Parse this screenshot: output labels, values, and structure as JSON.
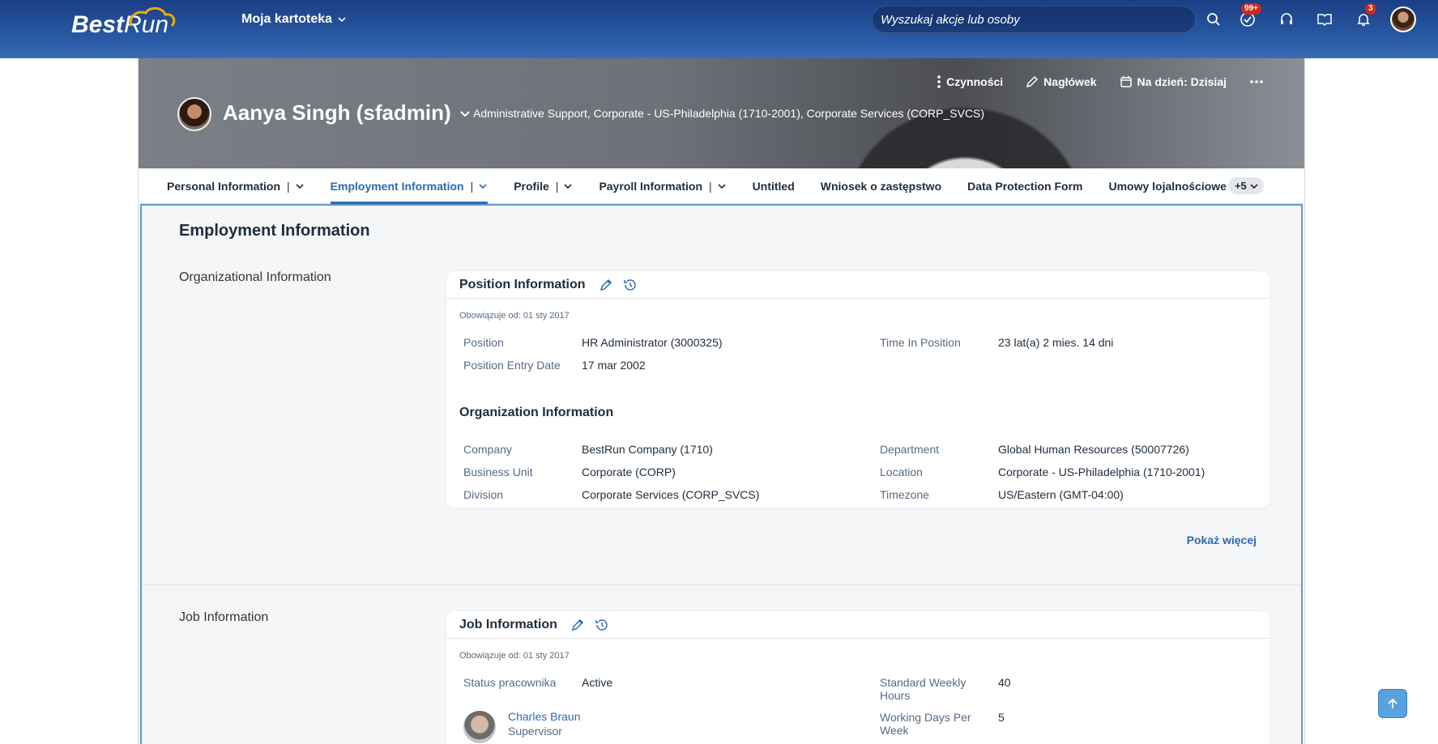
{
  "shell": {
    "logo_best": "Best",
    "logo_run": "Run",
    "menu_title": "Moja kartoteka",
    "search_placeholder": "Wyszukaj akcje lub osoby",
    "todo_badge": "99+",
    "notif_badge": "3",
    "icons": [
      "search-icon",
      "todo-icon",
      "support-icon",
      "learning-icon",
      "bell-icon"
    ]
  },
  "header": {
    "name": "Aanya Singh (sfadmin)",
    "subtitle": "Administrative Support, Corporate - US-Philadelphia (1710-2001), Corporate Services (CORP_SVCS)",
    "actions": {
      "czynnosci": "Czynności",
      "naglowek": "Nagłówek",
      "na_dzien": "Na dzień: Dzisiaj"
    }
  },
  "tabs": [
    {
      "label": "Personal Information"
    },
    {
      "label": "Employment Information"
    },
    {
      "label": "Profile"
    },
    {
      "label": "Payroll Information"
    },
    {
      "label": "Untitled"
    },
    {
      "label": "Wniosek o zastępstwo"
    },
    {
      "label": "Data Protection Form"
    },
    {
      "label": "Umowy lojalnościowe"
    }
  ],
  "tabs_more": "+5",
  "section": {
    "title": "Employment Information",
    "org_label": "Organizational Information",
    "job_label": "Job Information",
    "show_more": "Pokaż więcej"
  },
  "position_card": {
    "title": "Position Information",
    "effective": "Obowiązuje od: 01 sty 2017",
    "fields": {
      "position_label": "Position",
      "position_value": "HR Administrator (3000325)",
      "entry_label": "Position Entry Date",
      "entry_value": "17 mar 2002",
      "time_label": "Time In Position",
      "time_value": "23 lat(a) 2 mies. 14 dni"
    },
    "org_title": "Organization Information",
    "org": {
      "company_label": "Company",
      "company_value": "BestRun Company (1710)",
      "bu_label": "Business Unit",
      "bu_value": "Corporate (CORP)",
      "division_label": "Division",
      "division_value": "Corporate Services (CORP_SVCS)",
      "dept_label": "Department",
      "dept_value": "Global Human Resources (50007726)",
      "location_label": "Location",
      "location_value": "Corporate - US-Philadelphia (1710-2001)",
      "tz_label": "Timezone",
      "tz_value": "US/Eastern (GMT-04:00)"
    }
  },
  "job_card": {
    "title": "Job Information",
    "effective": "Obowiązuje od: 01 sty 2017",
    "status_label": "Status pracownika",
    "status_value": "Active",
    "hours_label": "Standard Weekly Hours",
    "hours_value": "40",
    "days_label": "Working Days Per Week",
    "days_value": "5",
    "supervisor_name": "Charles Braun",
    "supervisor_role": "Supervisor"
  },
  "colors": {
    "shell": "#1b3f86",
    "accent": "#2f6ab0",
    "frame": "#5b9bd5",
    "badge": "#d0271d"
  }
}
